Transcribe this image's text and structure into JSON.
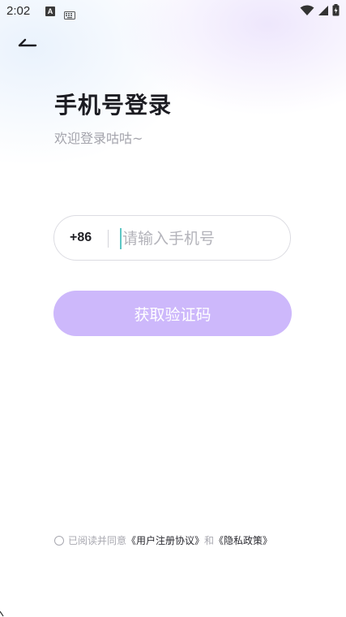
{
  "status_bar": {
    "time": "2:02",
    "notification_glyph": "A"
  },
  "login": {
    "title": "手机号登录",
    "subtitle": "欢迎登录咕咕~",
    "country_code": "+86",
    "phone_placeholder": "请输入手机号",
    "phone_value": "",
    "get_code_label": "获取验证码"
  },
  "agreement": {
    "prefix": "已阅读并同意",
    "user_agreement": "《用户注册协议》",
    "conjunction": "和",
    "privacy_policy": "《隐私政策》"
  },
  "colors": {
    "primary_button": "#cdb8fb",
    "cursor": "#5dc6c4",
    "title_text": "#1c1c22",
    "hint_text": "#a3a3ab"
  },
  "icons": [
    "back-arrow-icon",
    "keyboard-icon",
    "wifi-icon",
    "cellular-signal-icon",
    "battery-icon"
  ]
}
